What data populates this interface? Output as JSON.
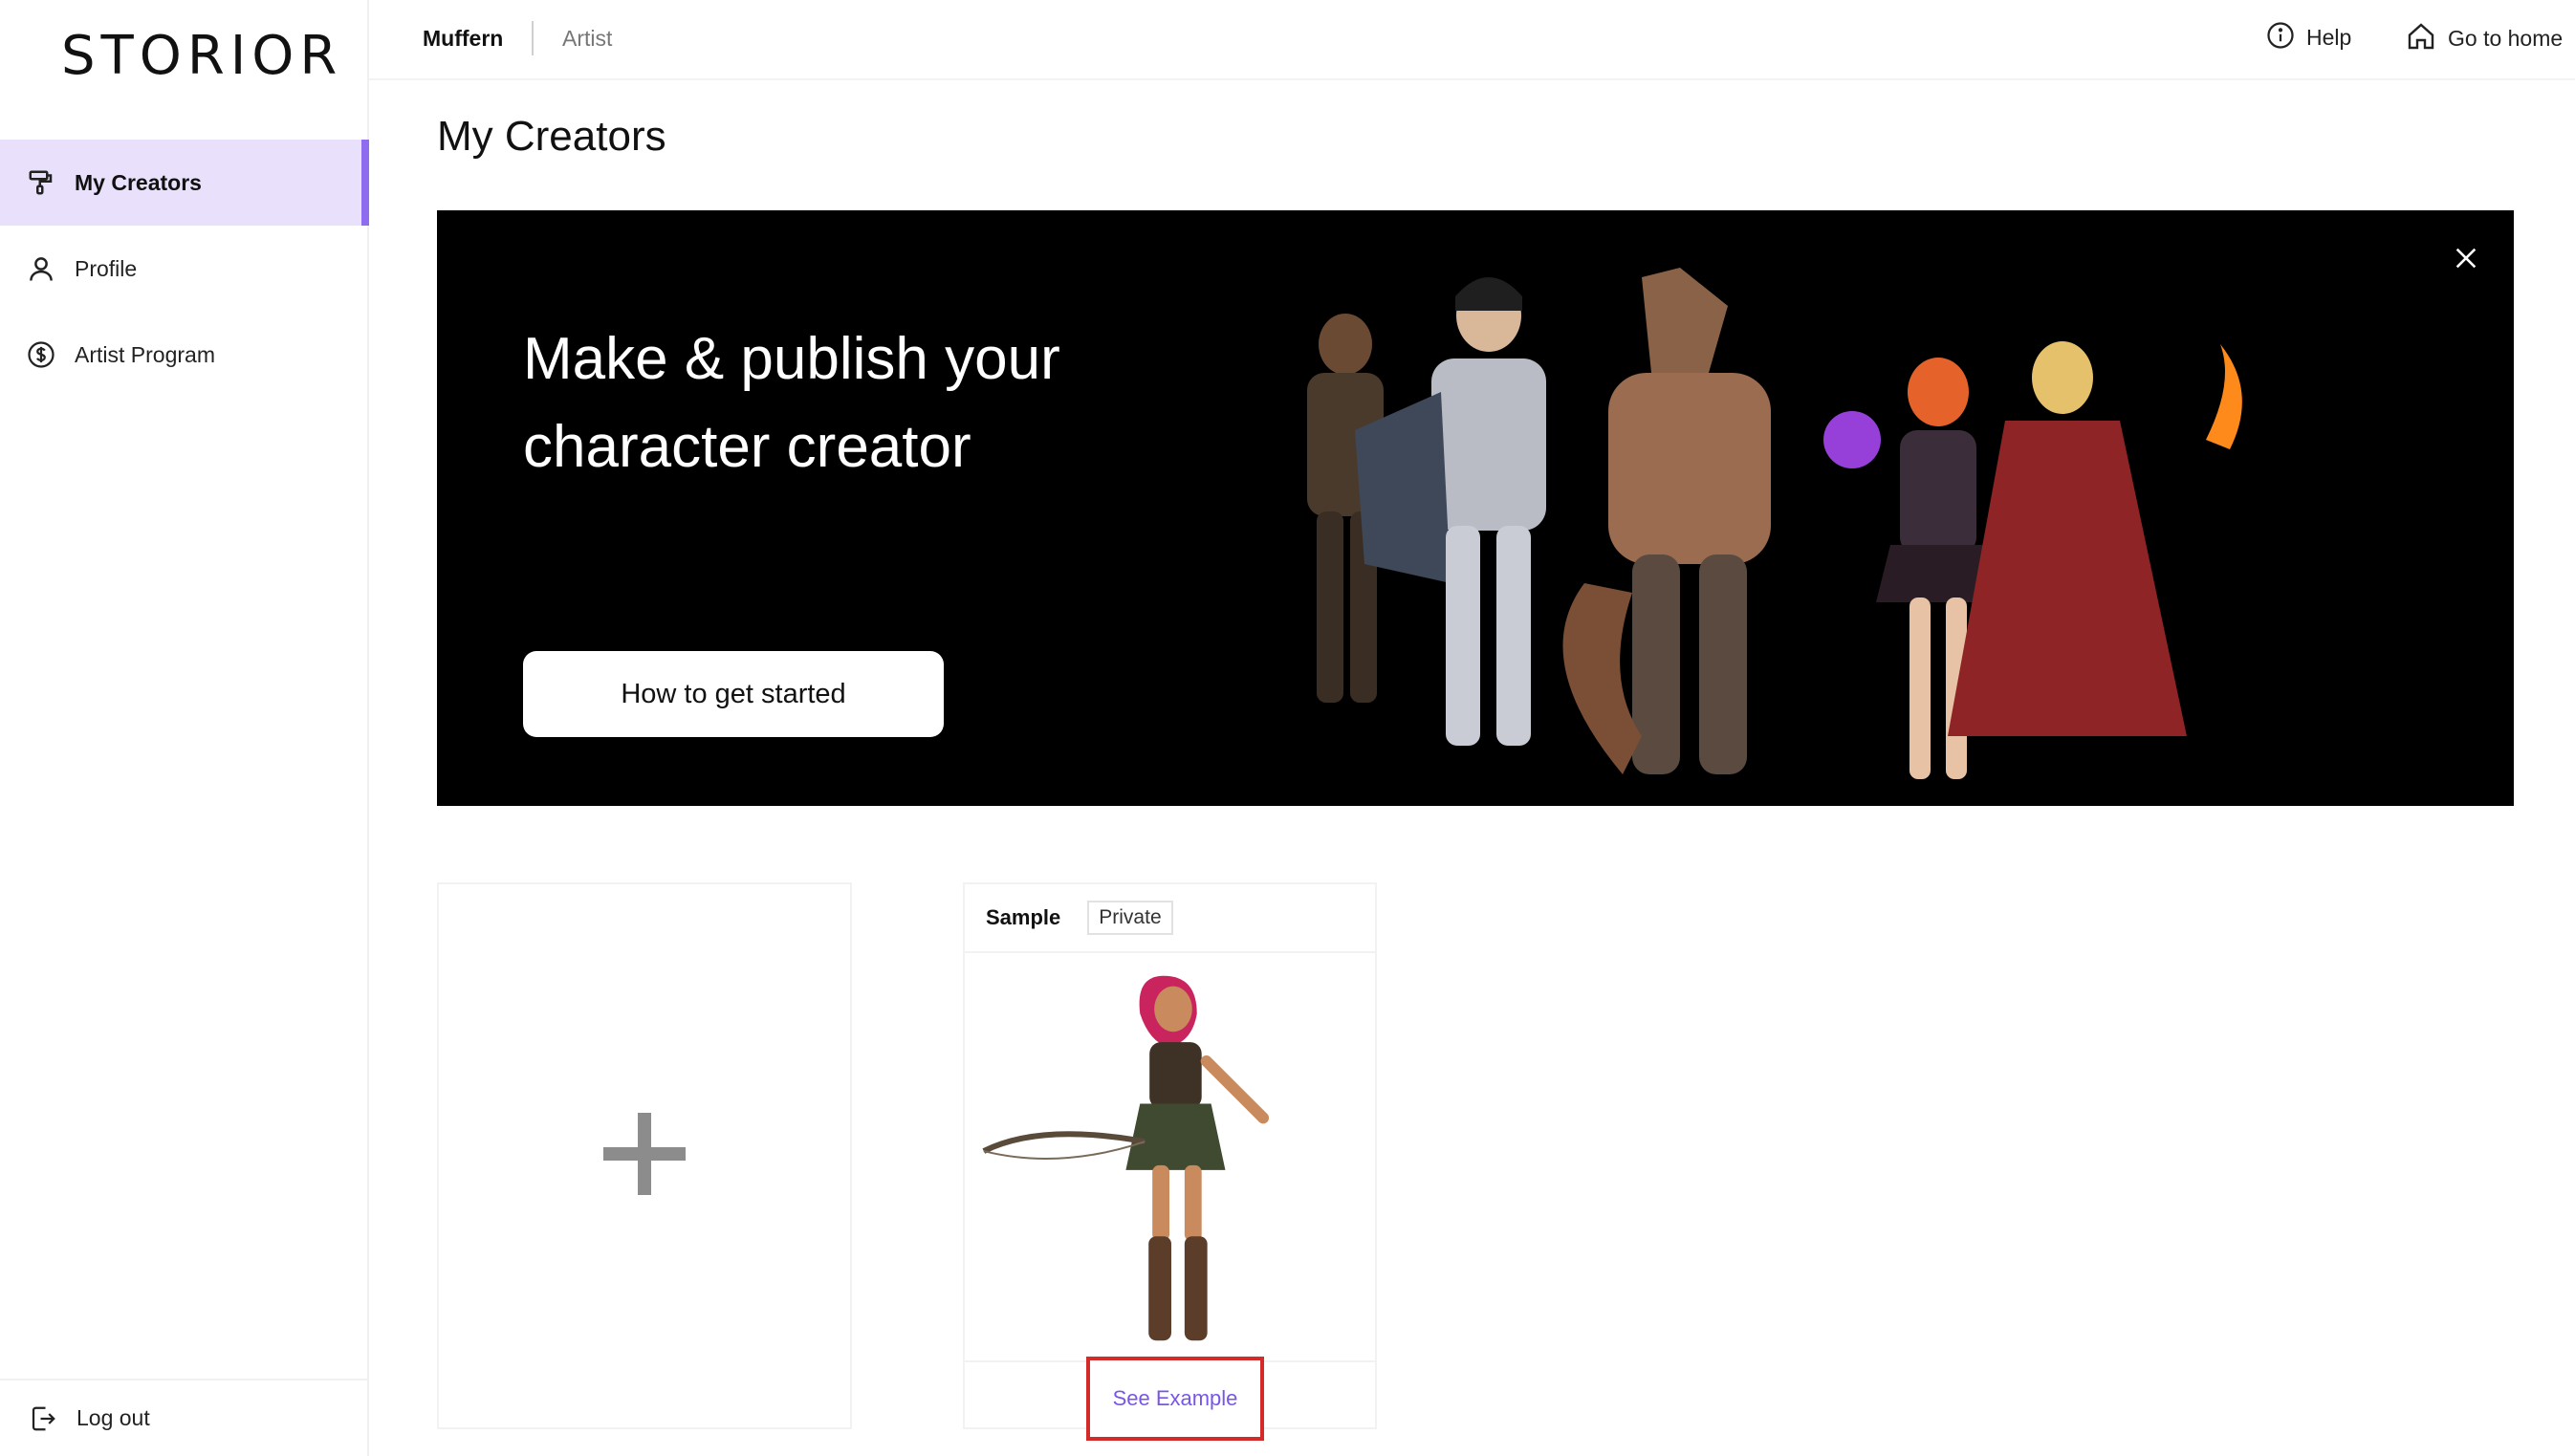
{
  "app": {
    "logo_text": "STORIOR"
  },
  "sidebar": {
    "items": [
      {
        "label": "My Creators",
        "icon": "paint-roller-icon",
        "active": true
      },
      {
        "label": "Profile",
        "icon": "user-icon",
        "active": false
      },
      {
        "label": "Artist Program",
        "icon": "dollar-circle-icon",
        "active": false
      }
    ],
    "logout_label": "Log out"
  },
  "header": {
    "breadcrumb": [
      "Muffern",
      "Artist"
    ],
    "help_label": "Help",
    "home_label": "Go to home"
  },
  "main": {
    "title": "My Creators",
    "banner": {
      "headline": "Make & publish your character creator",
      "button_label": "How to get started"
    },
    "cards": [
      {
        "title": "Sample",
        "badge": "Private",
        "action_label": "See Example"
      }
    ]
  },
  "colors": {
    "accent": "#8f6bf0",
    "active_bg": "#e9e0fb",
    "link": "#7a56e6",
    "highlight_box": "#d42a2a",
    "banner_bg": "#000000"
  }
}
